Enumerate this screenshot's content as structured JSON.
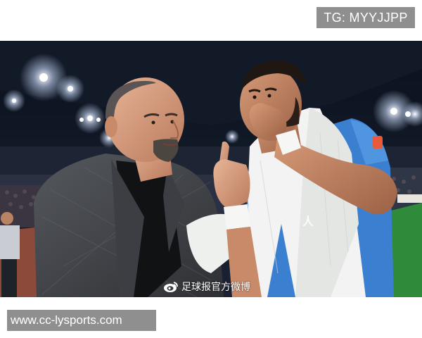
{
  "watermark_top": "TG: MYYJJPP",
  "photo": {
    "credit": "足球报官方微博",
    "credit_icon": "weibo-icon",
    "scene": "stadium-night-two-men-talking"
  },
  "watermark_bottom": "www.cc-lysports.com",
  "colors": {
    "badge_bg": "#8f8f8f",
    "pitch_green": "#2f8a3a",
    "jersey_blue": "#3a7fd0",
    "sky_dark": "#0d1320"
  }
}
